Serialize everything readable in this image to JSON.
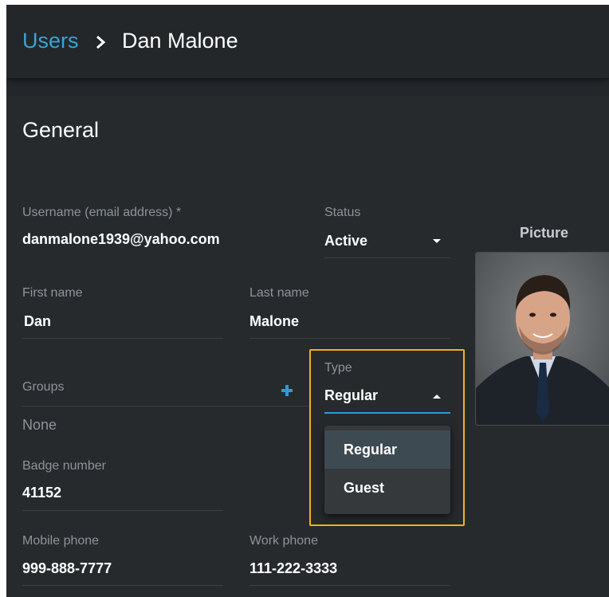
{
  "breadcrumb": {
    "parent": "Users",
    "current": "Dan Malone"
  },
  "section": {
    "title": "General"
  },
  "fields": {
    "username": {
      "label": "Username (email address) *",
      "value": "danmalone1939@yahoo.com"
    },
    "status": {
      "label": "Status",
      "value": "Active"
    },
    "first_name": {
      "label": "First name",
      "value": "Dan"
    },
    "last_name": {
      "label": "Last name",
      "value": "Malone"
    },
    "groups": {
      "label": "Groups",
      "value": "None"
    },
    "type": {
      "label": "Type",
      "value": "Regular",
      "options": [
        "Regular",
        "Guest"
      ],
      "highlighted_option": "Regular"
    },
    "badge": {
      "label": "Badge number",
      "value": "41152"
    },
    "mobile_phone": {
      "label": "Mobile phone",
      "value": "999-888-7777"
    },
    "work_phone": {
      "label": "Work phone",
      "value": "111-222-3333"
    }
  },
  "picture": {
    "label": "Picture"
  },
  "colors": {
    "link": "#3aa3d6",
    "accent": "#2d9bd6",
    "highlight": "#f2b01e",
    "background": "#262a2d"
  }
}
